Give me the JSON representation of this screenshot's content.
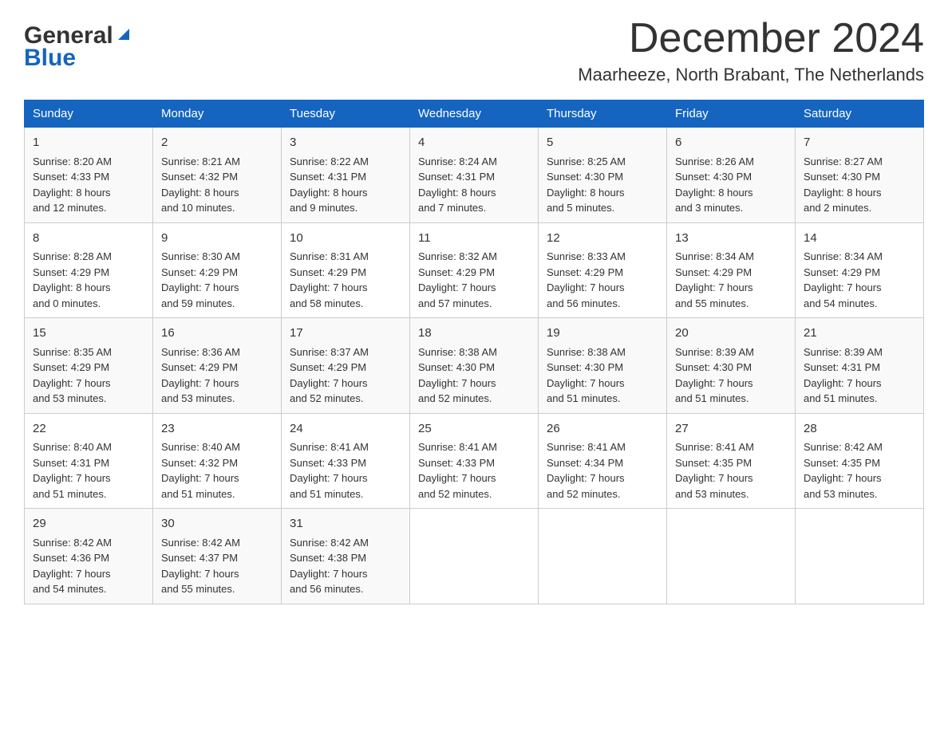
{
  "logo": {
    "general": "General",
    "blue": "Blue",
    "arrow": "▶"
  },
  "title": {
    "month_year": "December 2024",
    "location": "Maarheeze, North Brabant, The Netherlands"
  },
  "days_of_week": [
    "Sunday",
    "Monday",
    "Tuesday",
    "Wednesday",
    "Thursday",
    "Friday",
    "Saturday"
  ],
  "weeks": [
    [
      {
        "day": "1",
        "sunrise": "8:20 AM",
        "sunset": "4:33 PM",
        "daylight": "8 hours and 12 minutes."
      },
      {
        "day": "2",
        "sunrise": "8:21 AM",
        "sunset": "4:32 PM",
        "daylight": "8 hours and 10 minutes."
      },
      {
        "day": "3",
        "sunrise": "8:22 AM",
        "sunset": "4:31 PM",
        "daylight": "8 hours and 9 minutes."
      },
      {
        "day": "4",
        "sunrise": "8:24 AM",
        "sunset": "4:31 PM",
        "daylight": "8 hours and 7 minutes."
      },
      {
        "day": "5",
        "sunrise": "8:25 AM",
        "sunset": "4:30 PM",
        "daylight": "8 hours and 5 minutes."
      },
      {
        "day": "6",
        "sunrise": "8:26 AM",
        "sunset": "4:30 PM",
        "daylight": "8 hours and 3 minutes."
      },
      {
        "day": "7",
        "sunrise": "8:27 AM",
        "sunset": "4:30 PM",
        "daylight": "8 hours and 2 minutes."
      }
    ],
    [
      {
        "day": "8",
        "sunrise": "8:28 AM",
        "sunset": "4:29 PM",
        "daylight": "8 hours and 0 minutes."
      },
      {
        "day": "9",
        "sunrise": "8:30 AM",
        "sunset": "4:29 PM",
        "daylight": "7 hours and 59 minutes."
      },
      {
        "day": "10",
        "sunrise": "8:31 AM",
        "sunset": "4:29 PM",
        "daylight": "7 hours and 58 minutes."
      },
      {
        "day": "11",
        "sunrise": "8:32 AM",
        "sunset": "4:29 PM",
        "daylight": "7 hours and 57 minutes."
      },
      {
        "day": "12",
        "sunrise": "8:33 AM",
        "sunset": "4:29 PM",
        "daylight": "7 hours and 56 minutes."
      },
      {
        "day": "13",
        "sunrise": "8:34 AM",
        "sunset": "4:29 PM",
        "daylight": "7 hours and 55 minutes."
      },
      {
        "day": "14",
        "sunrise": "8:34 AM",
        "sunset": "4:29 PM",
        "daylight": "7 hours and 54 minutes."
      }
    ],
    [
      {
        "day": "15",
        "sunrise": "8:35 AM",
        "sunset": "4:29 PM",
        "daylight": "7 hours and 53 minutes."
      },
      {
        "day": "16",
        "sunrise": "8:36 AM",
        "sunset": "4:29 PM",
        "daylight": "7 hours and 53 minutes."
      },
      {
        "day": "17",
        "sunrise": "8:37 AM",
        "sunset": "4:29 PM",
        "daylight": "7 hours and 52 minutes."
      },
      {
        "day": "18",
        "sunrise": "8:38 AM",
        "sunset": "4:30 PM",
        "daylight": "7 hours and 52 minutes."
      },
      {
        "day": "19",
        "sunrise": "8:38 AM",
        "sunset": "4:30 PM",
        "daylight": "7 hours and 51 minutes."
      },
      {
        "day": "20",
        "sunrise": "8:39 AM",
        "sunset": "4:30 PM",
        "daylight": "7 hours and 51 minutes."
      },
      {
        "day": "21",
        "sunrise": "8:39 AM",
        "sunset": "4:31 PM",
        "daylight": "7 hours and 51 minutes."
      }
    ],
    [
      {
        "day": "22",
        "sunrise": "8:40 AM",
        "sunset": "4:31 PM",
        "daylight": "7 hours and 51 minutes."
      },
      {
        "day": "23",
        "sunrise": "8:40 AM",
        "sunset": "4:32 PM",
        "daylight": "7 hours and 51 minutes."
      },
      {
        "day": "24",
        "sunrise": "8:41 AM",
        "sunset": "4:33 PM",
        "daylight": "7 hours and 51 minutes."
      },
      {
        "day": "25",
        "sunrise": "8:41 AM",
        "sunset": "4:33 PM",
        "daylight": "7 hours and 52 minutes."
      },
      {
        "day": "26",
        "sunrise": "8:41 AM",
        "sunset": "4:34 PM",
        "daylight": "7 hours and 52 minutes."
      },
      {
        "day": "27",
        "sunrise": "8:41 AM",
        "sunset": "4:35 PM",
        "daylight": "7 hours and 53 minutes."
      },
      {
        "day": "28",
        "sunrise": "8:42 AM",
        "sunset": "4:35 PM",
        "daylight": "7 hours and 53 minutes."
      }
    ],
    [
      {
        "day": "29",
        "sunrise": "8:42 AM",
        "sunset": "4:36 PM",
        "daylight": "7 hours and 54 minutes."
      },
      {
        "day": "30",
        "sunrise": "8:42 AM",
        "sunset": "4:37 PM",
        "daylight": "7 hours and 55 minutes."
      },
      {
        "day": "31",
        "sunrise": "8:42 AM",
        "sunset": "4:38 PM",
        "daylight": "7 hours and 56 minutes."
      },
      null,
      null,
      null,
      null
    ]
  ],
  "labels": {
    "sunrise": "Sunrise:",
    "sunset": "Sunset:",
    "daylight": "Daylight:"
  }
}
